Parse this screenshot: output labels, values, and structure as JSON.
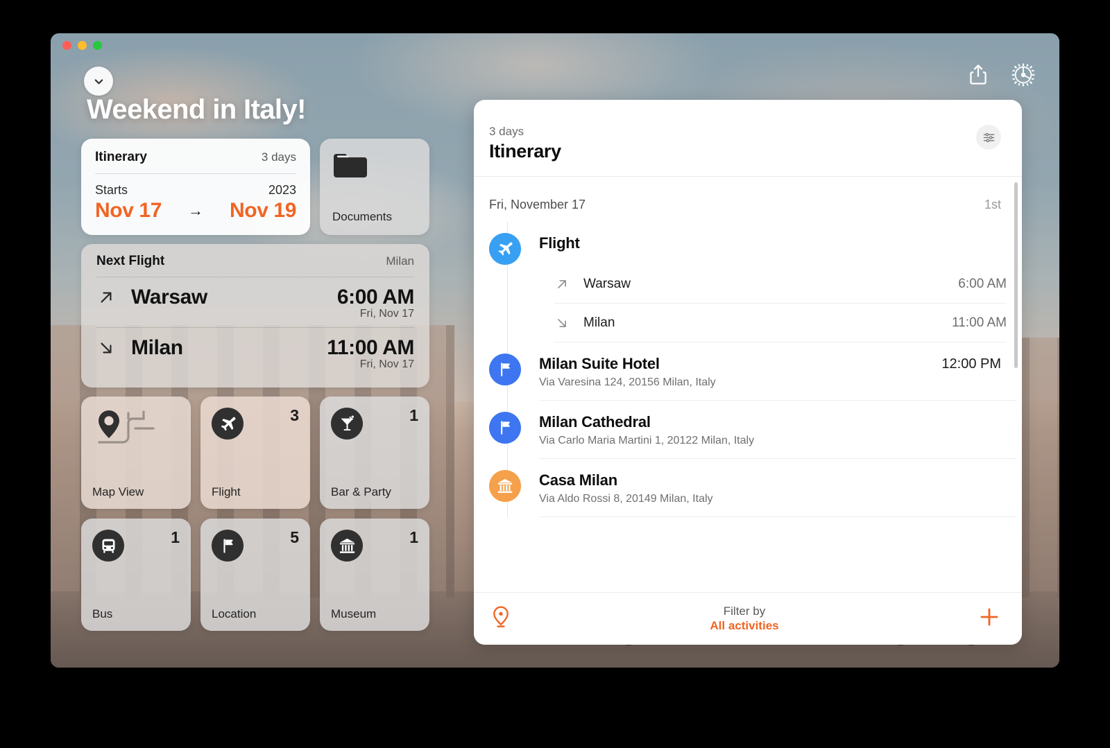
{
  "window": {
    "traffic_lights": [
      "close",
      "minimize",
      "zoom"
    ]
  },
  "header": {
    "trip_title": "Weekend in Italy!",
    "collapse_icon": "chevron-down-icon",
    "share_icon": "share-icon",
    "settings_icon": "gear-icon"
  },
  "itinerary_card": {
    "title": "Itinerary",
    "days": "3 days",
    "starts_label": "Starts",
    "year": "2023",
    "start_date": "Nov 17",
    "arrow": "→",
    "end_date": "Nov 19"
  },
  "documents_card": {
    "label": "Documents",
    "icon": "folder-icon"
  },
  "next_flight_card": {
    "title": "Next Flight",
    "destination": "Milan",
    "legs": [
      {
        "icon": "arrow-up-right-icon",
        "city": "Warsaw",
        "time": "6:00 AM",
        "date": "Fri, Nov 17"
      },
      {
        "icon": "arrow-down-right-icon",
        "city": "Milan",
        "time": "11:00 AM",
        "date": "Fri, Nov 17"
      }
    ]
  },
  "tiles": [
    {
      "label": "Map View",
      "count": "",
      "icon": "map-pin-icon",
      "theme": "warm"
    },
    {
      "label": "Flight",
      "count": "3",
      "icon": "airplane-icon",
      "theme": "warm2"
    },
    {
      "label": "Bar & Party",
      "count": "1",
      "icon": "cocktail-icon",
      "theme": "cool"
    },
    {
      "label": "Bus",
      "count": "1",
      "icon": "bus-icon",
      "theme": "cool"
    },
    {
      "label": "Location",
      "count": "5",
      "icon": "flag-icon",
      "theme": "cool"
    },
    {
      "label": "Museum",
      "count": "1",
      "icon": "museum-icon",
      "theme": "cool"
    }
  ],
  "panel": {
    "eyebrow": "3 days",
    "title": "Itinerary",
    "filter_icon": "sliders-icon",
    "day": {
      "date": "Fri, November 17",
      "ordinal": "1st"
    },
    "events": [
      {
        "name": "Flight",
        "address": "",
        "time": "",
        "icon": "airplane-icon",
        "color": "#38a0f3",
        "legs": [
          {
            "icon": "arrow-up-right-icon",
            "city": "Warsaw",
            "time": "6:00 AM"
          },
          {
            "icon": "arrow-down-right-icon",
            "city": "Milan",
            "time": "11:00 AM"
          }
        ]
      },
      {
        "name": "Milan Suite Hotel",
        "address": "Via Varesina 124, 20156 Milan, Italy",
        "time": "12:00 PM",
        "icon": "flag-icon",
        "color": "#3d76f0",
        "legs": []
      },
      {
        "name": "Milan Cathedral",
        "address": "Via Carlo Maria Martini 1, 20122 Milan, Italy",
        "time": "",
        "icon": "flag-icon",
        "color": "#3d76f0",
        "legs": []
      },
      {
        "name": "Casa Milan",
        "address": "Via Aldo Rossi 8, 20149 Milan, Italy",
        "time": "",
        "icon": "museum-icon",
        "color": "#f5a04a",
        "legs": []
      }
    ],
    "footer": {
      "pin_icon": "location-pin-icon",
      "filter_label": "Filter by",
      "filter_value": "All activities",
      "add_icon": "plus-icon"
    }
  },
  "colors": {
    "accent_orange": "#f26422",
    "flight_blue": "#38a0f3",
    "flag_blue": "#3d76f0",
    "museum_orange": "#f5a04a"
  }
}
